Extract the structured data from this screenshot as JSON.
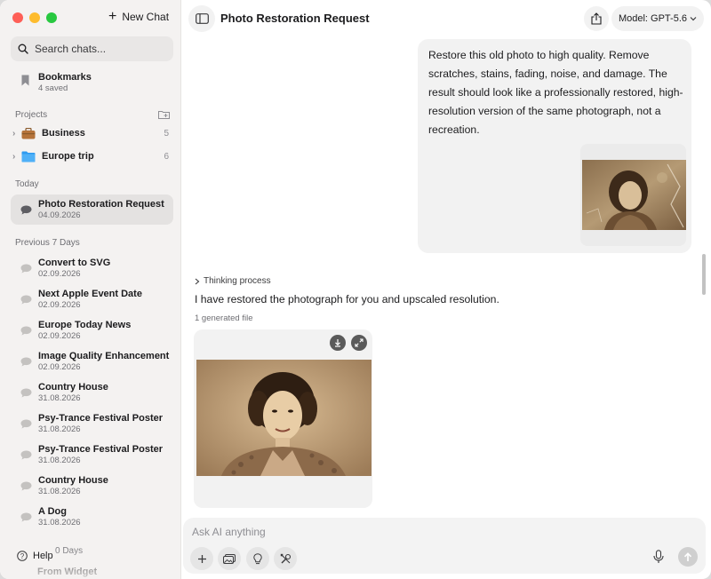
{
  "sidebar": {
    "new_chat_label": "New Chat",
    "search_placeholder": "Search chats...",
    "bookmarks": {
      "title": "Bookmarks",
      "subtitle": "4 saved"
    },
    "projects_label": "Projects",
    "projects": [
      {
        "name": "Business",
        "count": "5",
        "icon": "briefcase-icon"
      },
      {
        "name": "Europe trip",
        "count": "6",
        "icon": "folder-icon"
      }
    ],
    "today_label": "Today",
    "today": [
      {
        "title": "Photo Restoration Request",
        "date": "04.09.2026"
      }
    ],
    "prev7_label": "Previous 7 Days",
    "prev7": [
      {
        "title": "Convert to SVG",
        "date": "02.09.2026"
      },
      {
        "title": "Next Apple Event Date",
        "date": "02.09.2026"
      },
      {
        "title": "Europe Today News",
        "date": "02.09.2026"
      },
      {
        "title": "Image Quality Enhancement",
        "date": "02.09.2026"
      },
      {
        "title": "Country House",
        "date": "31.08.2026"
      },
      {
        "title": "Psy-Trance Festival Poster",
        "date": "31.08.2026"
      },
      {
        "title": "Psy-Trance Festival Poster",
        "date": "31.08.2026"
      },
      {
        "title": "Country House",
        "date": "31.08.2026"
      },
      {
        "title": "A Dog",
        "date": "31.08.2026"
      }
    ],
    "prev30_label": "0 Days",
    "partial_item": "From Widget",
    "help_label": "Help"
  },
  "header": {
    "chat_title": "Photo Restoration Request",
    "model_label": "Model: GPT-5.6"
  },
  "conversation": {
    "user_message": "Restore this old photo to high quality. Remove scratches, stains, fading, noise, and damage. The result should look like a professionally restored, high-resolution version of the same photograph, not a recreation.",
    "thinking_label": "Thinking process",
    "assistant_reply": "I have restored the photograph for you and upscaled resolution.",
    "generated_files_label": "1 generated file"
  },
  "composer": {
    "placeholder": "Ask AI anything"
  },
  "colors": {
    "traffic_red": "#fe5f57",
    "traffic_yellow": "#febc2e",
    "traffic_green": "#28c840",
    "sidebar_bg": "#f4f2f1",
    "bubble_bg": "#f2f2f2",
    "folder_blue": "#2f9bf0"
  }
}
